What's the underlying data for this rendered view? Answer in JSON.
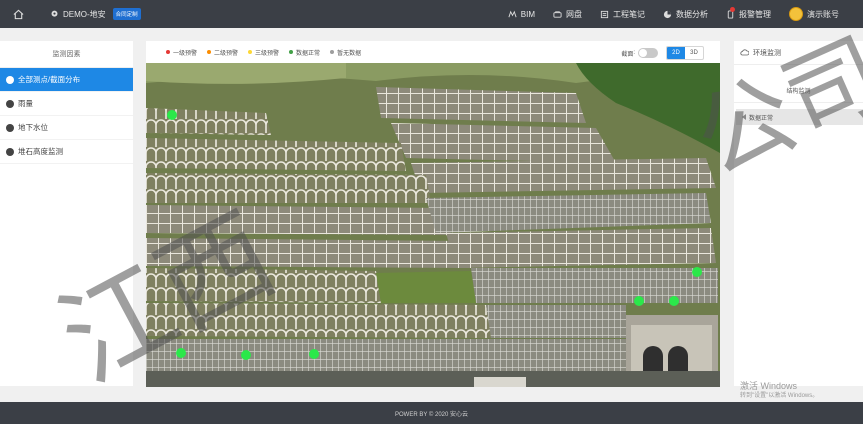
{
  "topbar": {
    "project_name": "DEMO-地安",
    "project_tag": "合同定制",
    "nav": [
      {
        "label": "BIM",
        "icon": "bim-icon"
      },
      {
        "label": "网盘",
        "icon": "cloud-disk-icon"
      },
      {
        "label": "工程笔记",
        "icon": "notebook-icon"
      },
      {
        "label": "数据分析",
        "icon": "chart-pie-icon"
      },
      {
        "label": "报警管理",
        "icon": "phone-alarm-icon"
      }
    ],
    "user_name": "演示账号"
  },
  "left_panel": {
    "title": "监测因素",
    "items": [
      {
        "label": "全部测点/截面分布",
        "active": true
      },
      {
        "label": "雨量",
        "active": false
      },
      {
        "label": "地下水位",
        "active": false
      },
      {
        "label": "堆石高度监测",
        "active": false
      }
    ]
  },
  "center": {
    "legend": [
      {
        "label": "一级预警",
        "color": "#e53935"
      },
      {
        "label": "二级预警",
        "color": "#fb8c00"
      },
      {
        "label": "三级预警",
        "color": "#fdd835"
      },
      {
        "label": "数据正常",
        "color": "#43a047"
      },
      {
        "label": "暂无数据",
        "color": "#9e9e9e"
      }
    ],
    "label_toggle": "截面",
    "view_2d": "2D",
    "view_3d": "3D",
    "active_view": "2D"
  },
  "right_panel": {
    "header": "环境监测",
    "sub_title": "结构监测",
    "pill": "数据正常"
  },
  "activation": {
    "title": "激活 Windows",
    "subtitle": "转到\"设置\"以激活 Windows。"
  },
  "footer": "POWER BY © 2020 安心云",
  "watermark": {
    "left": "江西",
    "right": "公司"
  }
}
